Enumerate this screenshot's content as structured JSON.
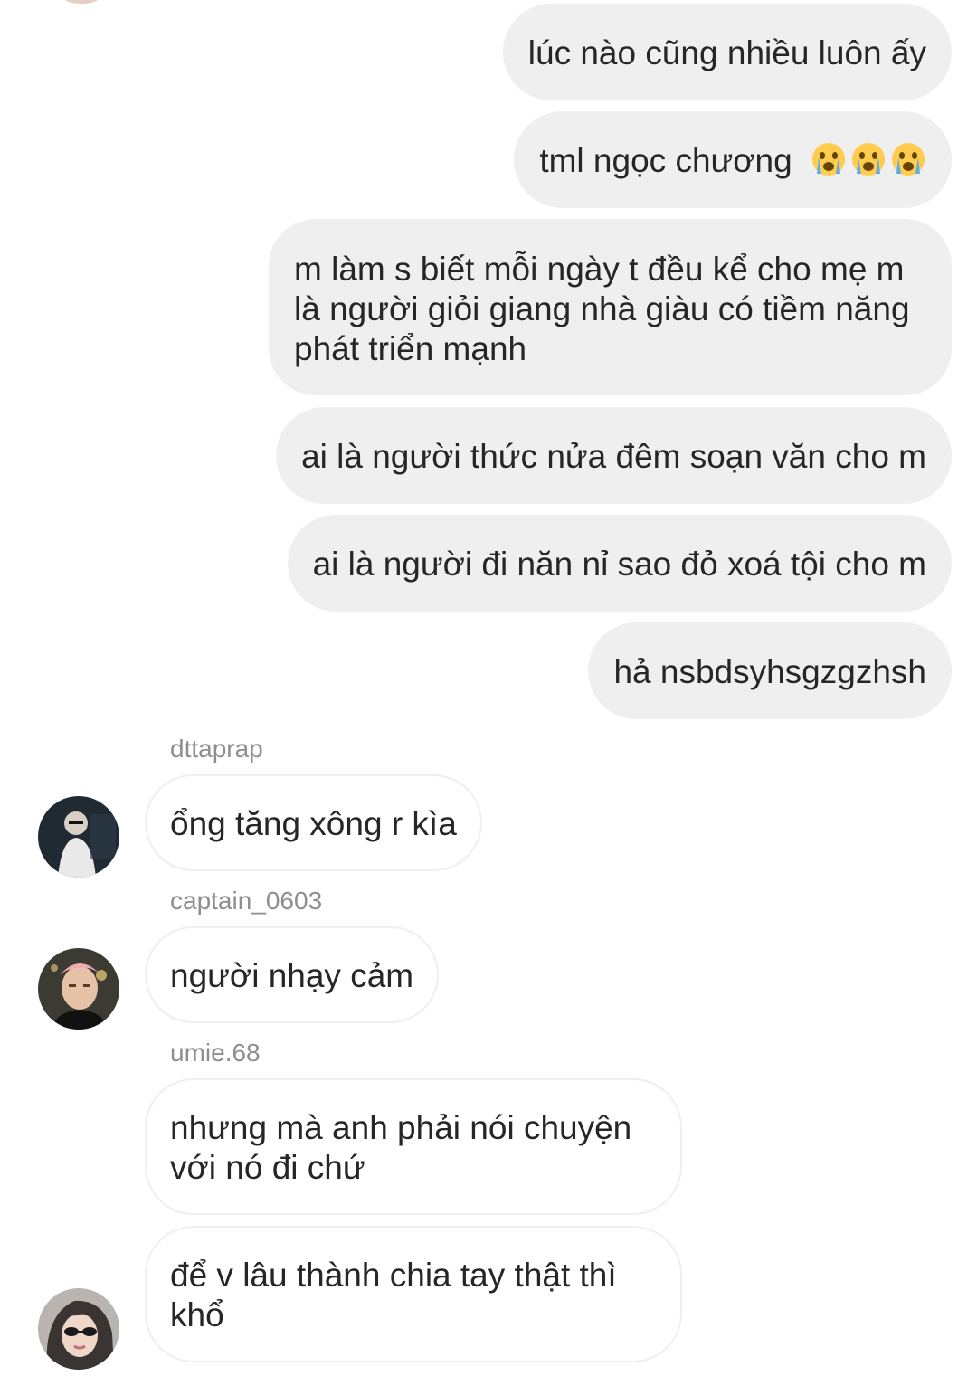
{
  "outgoing": [
    {
      "text": "lúc nào cũng nhiều luôn ấy"
    },
    {
      "text": "tml ngọc chương",
      "emoji": "😭😭😭"
    },
    {
      "text": "m làm s biết mỗi ngày t đều kể cho mẹ m là người giỏi giang nhà giàu có tiềm năng phát triển mạnh"
    },
    {
      "text": "ai là người thức nửa đêm soạn văn cho m"
    },
    {
      "text": "ai là người đi năn nỉ sao đỏ xoá tội cho m"
    },
    {
      "text": "hả nsbdsyhsgzgzhsh"
    }
  ],
  "incoming": [
    {
      "sender": "dttaprap",
      "text": "ổng tăng xông r kìa"
    },
    {
      "sender": "captain_0603",
      "text": "người nhạy cảm"
    },
    {
      "sender": "umie.68",
      "text": "nhưng mà anh phải nói chuyện với nó đi chứ"
    },
    {
      "text": "để v lâu thành chia tay thật thì khổ"
    }
  ],
  "colors": {
    "outgoing_bubble": "#efefef",
    "incoming_border": "#efefef",
    "sender_name": "#8e8e8e",
    "text": "#262626"
  }
}
